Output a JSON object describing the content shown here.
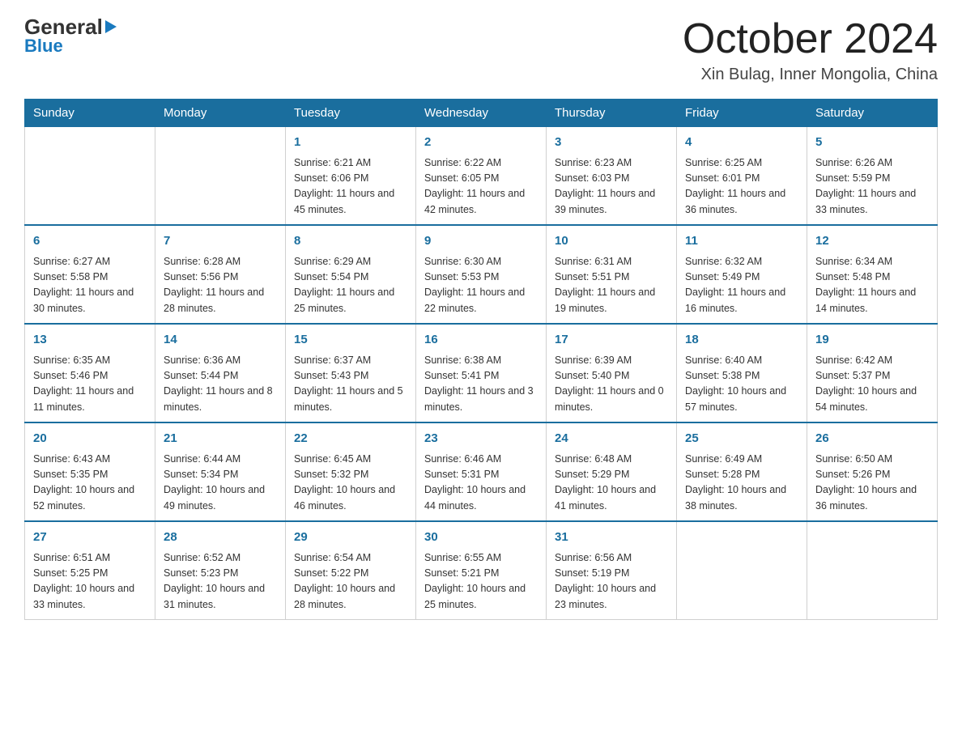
{
  "header": {
    "logo_general": "General",
    "logo_blue": "Blue",
    "month_title": "October 2024",
    "location": "Xin Bulag, Inner Mongolia, China"
  },
  "calendar": {
    "days_of_week": [
      "Sunday",
      "Monday",
      "Tuesday",
      "Wednesday",
      "Thursday",
      "Friday",
      "Saturday"
    ],
    "weeks": [
      [
        {
          "day": "",
          "info": ""
        },
        {
          "day": "",
          "info": ""
        },
        {
          "day": "1",
          "info": "Sunrise: 6:21 AM\nSunset: 6:06 PM\nDaylight: 11 hours\nand 45 minutes."
        },
        {
          "day": "2",
          "info": "Sunrise: 6:22 AM\nSunset: 6:05 PM\nDaylight: 11 hours\nand 42 minutes."
        },
        {
          "day": "3",
          "info": "Sunrise: 6:23 AM\nSunset: 6:03 PM\nDaylight: 11 hours\nand 39 minutes."
        },
        {
          "day": "4",
          "info": "Sunrise: 6:25 AM\nSunset: 6:01 PM\nDaylight: 11 hours\nand 36 minutes."
        },
        {
          "day": "5",
          "info": "Sunrise: 6:26 AM\nSunset: 5:59 PM\nDaylight: 11 hours\nand 33 minutes."
        }
      ],
      [
        {
          "day": "6",
          "info": "Sunrise: 6:27 AM\nSunset: 5:58 PM\nDaylight: 11 hours\nand 30 minutes."
        },
        {
          "day": "7",
          "info": "Sunrise: 6:28 AM\nSunset: 5:56 PM\nDaylight: 11 hours\nand 28 minutes."
        },
        {
          "day": "8",
          "info": "Sunrise: 6:29 AM\nSunset: 5:54 PM\nDaylight: 11 hours\nand 25 minutes."
        },
        {
          "day": "9",
          "info": "Sunrise: 6:30 AM\nSunset: 5:53 PM\nDaylight: 11 hours\nand 22 minutes."
        },
        {
          "day": "10",
          "info": "Sunrise: 6:31 AM\nSunset: 5:51 PM\nDaylight: 11 hours\nand 19 minutes."
        },
        {
          "day": "11",
          "info": "Sunrise: 6:32 AM\nSunset: 5:49 PM\nDaylight: 11 hours\nand 16 minutes."
        },
        {
          "day": "12",
          "info": "Sunrise: 6:34 AM\nSunset: 5:48 PM\nDaylight: 11 hours\nand 14 minutes."
        }
      ],
      [
        {
          "day": "13",
          "info": "Sunrise: 6:35 AM\nSunset: 5:46 PM\nDaylight: 11 hours\nand 11 minutes."
        },
        {
          "day": "14",
          "info": "Sunrise: 6:36 AM\nSunset: 5:44 PM\nDaylight: 11 hours\nand 8 minutes."
        },
        {
          "day": "15",
          "info": "Sunrise: 6:37 AM\nSunset: 5:43 PM\nDaylight: 11 hours\nand 5 minutes."
        },
        {
          "day": "16",
          "info": "Sunrise: 6:38 AM\nSunset: 5:41 PM\nDaylight: 11 hours\nand 3 minutes."
        },
        {
          "day": "17",
          "info": "Sunrise: 6:39 AM\nSunset: 5:40 PM\nDaylight: 11 hours\nand 0 minutes."
        },
        {
          "day": "18",
          "info": "Sunrise: 6:40 AM\nSunset: 5:38 PM\nDaylight: 10 hours\nand 57 minutes."
        },
        {
          "day": "19",
          "info": "Sunrise: 6:42 AM\nSunset: 5:37 PM\nDaylight: 10 hours\nand 54 minutes."
        }
      ],
      [
        {
          "day": "20",
          "info": "Sunrise: 6:43 AM\nSunset: 5:35 PM\nDaylight: 10 hours\nand 52 minutes."
        },
        {
          "day": "21",
          "info": "Sunrise: 6:44 AM\nSunset: 5:34 PM\nDaylight: 10 hours\nand 49 minutes."
        },
        {
          "day": "22",
          "info": "Sunrise: 6:45 AM\nSunset: 5:32 PM\nDaylight: 10 hours\nand 46 minutes."
        },
        {
          "day": "23",
          "info": "Sunrise: 6:46 AM\nSunset: 5:31 PM\nDaylight: 10 hours\nand 44 minutes."
        },
        {
          "day": "24",
          "info": "Sunrise: 6:48 AM\nSunset: 5:29 PM\nDaylight: 10 hours\nand 41 minutes."
        },
        {
          "day": "25",
          "info": "Sunrise: 6:49 AM\nSunset: 5:28 PM\nDaylight: 10 hours\nand 38 minutes."
        },
        {
          "day": "26",
          "info": "Sunrise: 6:50 AM\nSunset: 5:26 PM\nDaylight: 10 hours\nand 36 minutes."
        }
      ],
      [
        {
          "day": "27",
          "info": "Sunrise: 6:51 AM\nSunset: 5:25 PM\nDaylight: 10 hours\nand 33 minutes."
        },
        {
          "day": "28",
          "info": "Sunrise: 6:52 AM\nSunset: 5:23 PM\nDaylight: 10 hours\nand 31 minutes."
        },
        {
          "day": "29",
          "info": "Sunrise: 6:54 AM\nSunset: 5:22 PM\nDaylight: 10 hours\nand 28 minutes."
        },
        {
          "day": "30",
          "info": "Sunrise: 6:55 AM\nSunset: 5:21 PM\nDaylight: 10 hours\nand 25 minutes."
        },
        {
          "day": "31",
          "info": "Sunrise: 6:56 AM\nSunset: 5:19 PM\nDaylight: 10 hours\nand 23 minutes."
        },
        {
          "day": "",
          "info": ""
        },
        {
          "day": "",
          "info": ""
        }
      ]
    ]
  }
}
